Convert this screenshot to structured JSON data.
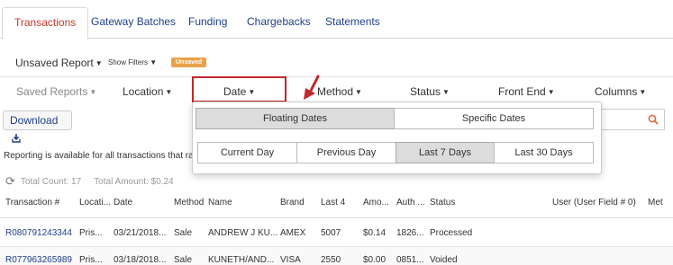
{
  "tabs": [
    {
      "label": "Transactions",
      "active": true
    },
    {
      "label": "Gateway Batches"
    },
    {
      "label": "Funding"
    },
    {
      "label": "Chargebacks"
    },
    {
      "label": "Statements"
    }
  ],
  "report": {
    "name": "Unsaved Report",
    "show_filters": "Show Filters",
    "badge": "Unsaved"
  },
  "filters": {
    "saved_reports": "Saved Reports",
    "location": "Location",
    "date": "Date",
    "method": "Method",
    "status": "Status",
    "front_end": "Front End",
    "columns": "Columns"
  },
  "toolbar": {
    "download": "Download"
  },
  "date_dropdown": {
    "modes": [
      "Floating Dates",
      "Specific Dates"
    ],
    "active_mode": "Floating Dates",
    "ranges": [
      "Current Day",
      "Previous Day",
      "Last 7 Days",
      "Last 30 Days"
    ],
    "active_range": "Last 7 Days"
  },
  "notice": "Reporting is available for all transactions that ran i",
  "summary": {
    "total_count": "Total Count: 17",
    "total_amount": "Total Amount: $0.24"
  },
  "table": {
    "headers": [
      "Transaction #",
      "Locati...",
      "Date",
      "Method",
      "Name",
      "Brand",
      "Last 4",
      "Amo...",
      "Auth ...",
      "Status",
      "User (User Field # 0)",
      "Met"
    ],
    "rows": [
      [
        "R080791243344",
        "Pris...",
        "03/21/2018...",
        "Sale",
        "ANDREW J KU...",
        "AMEX",
        "5007",
        "$0.14",
        "1826...",
        "Processed"
      ],
      [
        "R077963265989",
        "Pris...",
        "03/18/2018...",
        "Sale",
        "KUNETH/AND...",
        "VISA",
        "2550",
        "$0.00",
        "0851...",
        "Voided"
      ]
    ]
  },
  "colors": {
    "link": "#1f3f8a",
    "active_tab": "#c0392b",
    "highlight": "#c0282d",
    "badge": "#e8a24a",
    "search_icon": "#e06a3a"
  }
}
